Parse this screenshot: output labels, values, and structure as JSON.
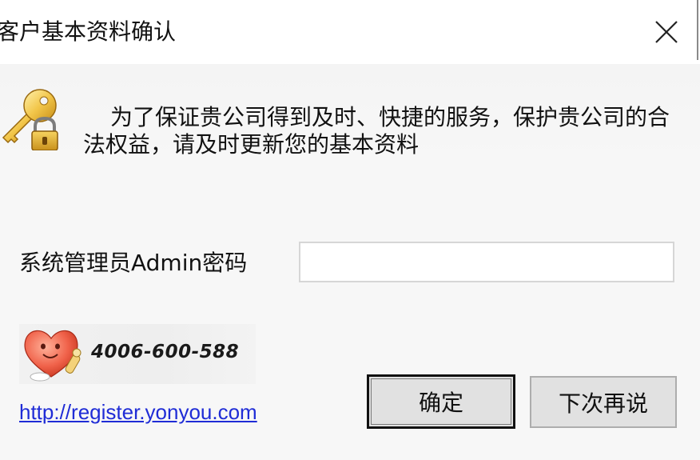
{
  "window": {
    "title": "客户基本资料确认",
    "close_icon": "close-icon"
  },
  "message": {
    "icon": "key-lock-icon",
    "text": "为了保证贵公司得到及时、快捷的服务，保护贵公司的合法权益，请及时更新您的基本资料"
  },
  "form": {
    "password_label": "系统管理员Admin密码",
    "password_value": "",
    "password_placeholder": ""
  },
  "support": {
    "icon": "heart-mascot-icon",
    "phone": "4006-600-588",
    "link": "http://register.yonyou.com"
  },
  "buttons": {
    "ok_label": "确定",
    "later_label": "下次再说"
  },
  "colors": {
    "link": "#1f2cd6",
    "button_face": "#e1e1e1",
    "dialog_bg": "#f7f7f7"
  }
}
